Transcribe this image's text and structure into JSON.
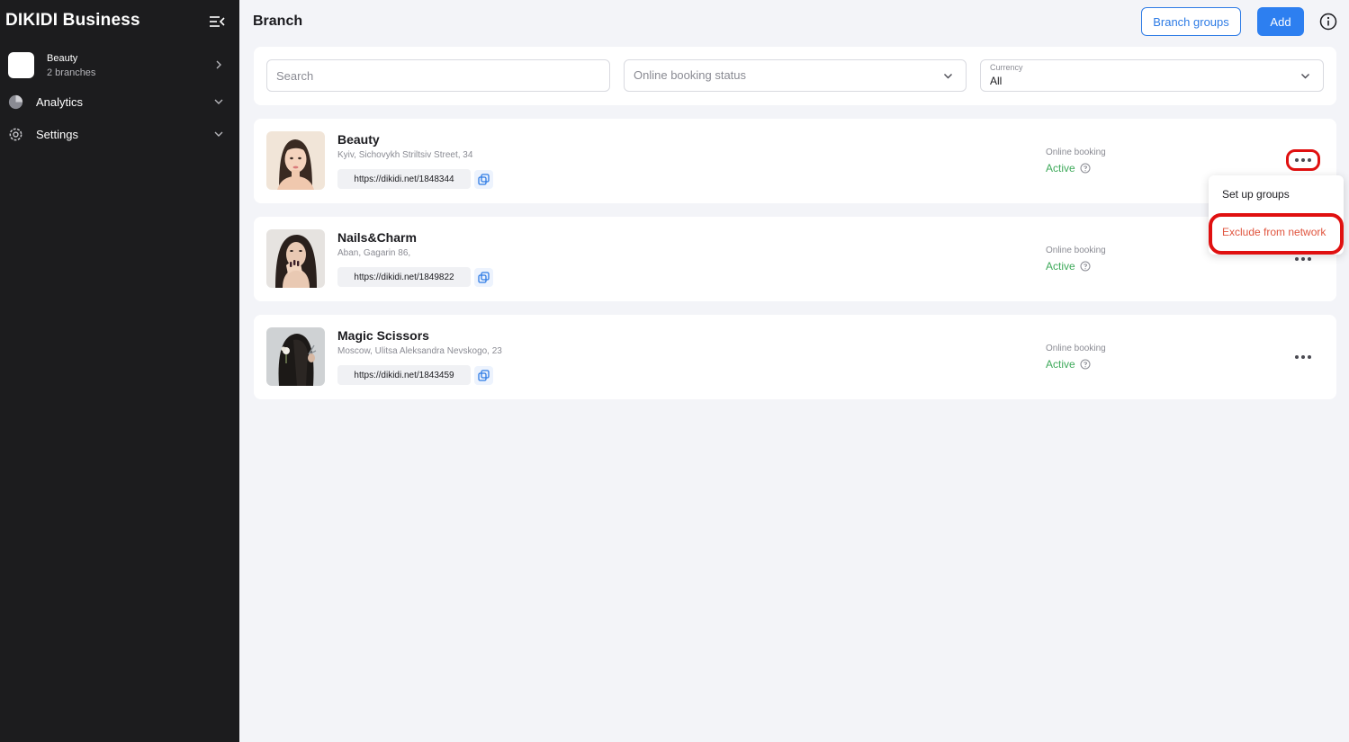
{
  "sidebar": {
    "brand": "DIKIDI Business",
    "org": {
      "name": "Beauty",
      "subtitle": "2 branches"
    },
    "nav": [
      {
        "label": "Analytics",
        "icon": "pie-chart-icon"
      },
      {
        "label": "Settings",
        "icon": "gear-icon"
      }
    ]
  },
  "header": {
    "title": "Branch",
    "branch_groups_label": "Branch groups",
    "add_label": "Add"
  },
  "filters": {
    "search_placeholder": "Search",
    "status_placeholder": "Online booking status",
    "currency_label": "Currency",
    "currency_value": "All"
  },
  "branches": [
    {
      "name": "Beauty",
      "address": "Kyiv, Sichovykh Striltsiv Street, 34",
      "link": "https://dikidi.net/1848344",
      "booking_label": "Online booking",
      "booking_status": "Active"
    },
    {
      "name": "Nails&Charm",
      "address": "Aban, Gagarin 86,",
      "link": "https://dikidi.net/1849822",
      "booking_label": "Online booking",
      "booking_status": "Active"
    },
    {
      "name": "Magic Scissors",
      "address": "Moscow, Ulitsa Aleksandra Nevskogo, 23",
      "link": "https://dikidi.net/1843459",
      "booking_label": "Online booking",
      "booking_status": "Active"
    }
  ],
  "menu": {
    "setup_groups": "Set up groups",
    "exclude": "Exclude from network"
  },
  "colors": {
    "accent": "#2d7ff0",
    "active_status": "#3faa5b",
    "highlight": "#e01010",
    "sidebar_bg": "#1c1c1e"
  }
}
